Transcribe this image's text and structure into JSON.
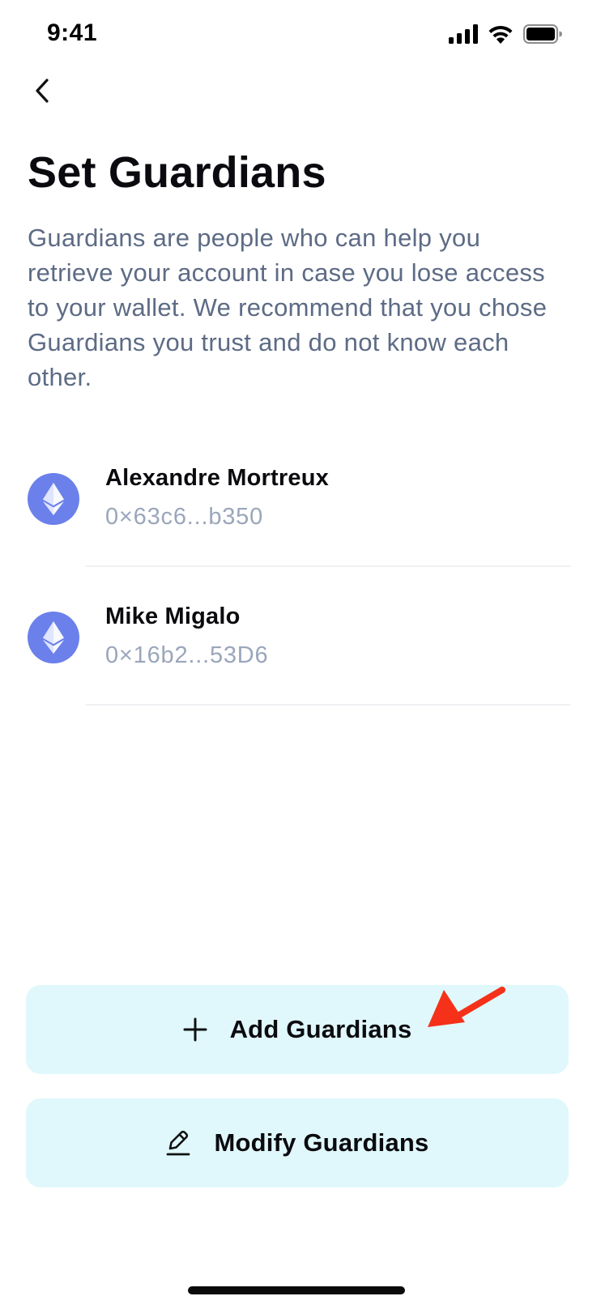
{
  "status_bar": {
    "time": "9:41",
    "icons": [
      "signal-icon",
      "wifi-icon",
      "battery-icon"
    ]
  },
  "header": {
    "back_icon": "chevron-left-icon",
    "title": "Set Guardians",
    "description": "Guardians are people who can help you retrieve your account in case you lose access to your wallet. We recommend that you chose Guardians you trust and do not know each other."
  },
  "guardians": [
    {
      "name": "Alexandre Mortreux",
      "address": "0×63c6...b350",
      "icon": "ethereum-icon"
    },
    {
      "name": "Mike Migalo",
      "address": "0×16b2...53D6",
      "icon": "ethereum-icon"
    }
  ],
  "buttons": {
    "add": {
      "label": "Add Guardians",
      "icon": "plus-icon"
    },
    "modify": {
      "label": "Modify Guardians",
      "icon": "pencil-icon"
    }
  },
  "colors": {
    "accent_avatar": "#6b80ea",
    "button_bg": "#e0f8fb",
    "description_text": "#5d6b85",
    "address_text": "#9aa6bb",
    "annotation_arrow": "#f5311a"
  }
}
